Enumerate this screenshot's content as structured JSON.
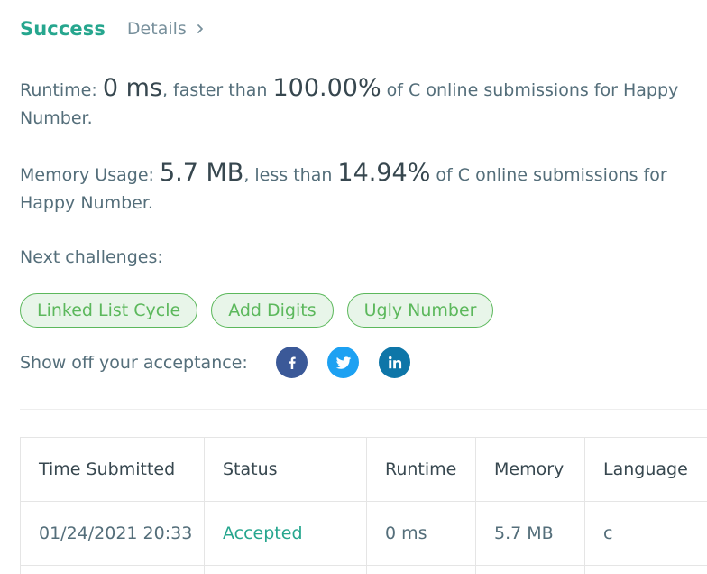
{
  "header": {
    "status": "Success",
    "details_label": "Details"
  },
  "runtime": {
    "label": "Runtime:",
    "value": "0 ms",
    "mid": ", faster than",
    "percent": "100.00%",
    "tail": "of C online submissions for Happy Number."
  },
  "memory": {
    "label": "Memory Usage:",
    "value": "5.7 MB",
    "mid": ", less than",
    "percent": "14.94%",
    "tail": "of C online submissions for Happy Number."
  },
  "next_challenges": {
    "label": "Next challenges:",
    "items": [
      "Linked List Cycle",
      "Add Digits",
      "Ugly Number"
    ]
  },
  "share": {
    "label": "Show off your acceptance:",
    "icons": [
      "facebook-icon",
      "twitter-icon",
      "linkedin-icon"
    ]
  },
  "table": {
    "headers": [
      "Time Submitted",
      "Status",
      "Runtime",
      "Memory",
      "Language"
    ],
    "rows": [
      [
        "01/24/2021 20:33",
        "Accepted",
        "0 ms",
        "5.7 MB",
        "c"
      ]
    ]
  },
  "colors": {
    "success": "#26a68e",
    "chip_border": "#5cb85c",
    "chip_bg": "#e8f5e9",
    "facebook": "#3b5998",
    "twitter": "#1da1f2",
    "linkedin": "#0e76a8"
  }
}
